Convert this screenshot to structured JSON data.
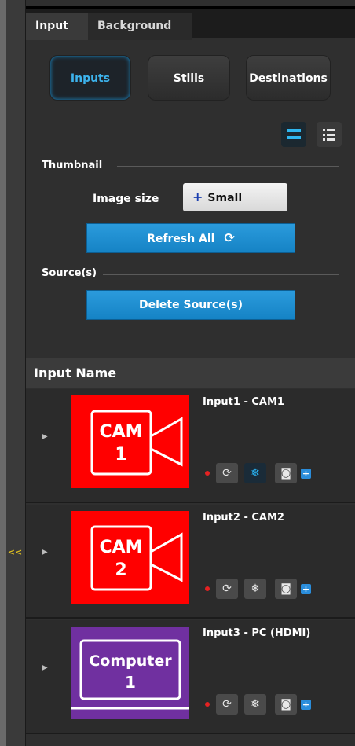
{
  "collapse_label": "<<",
  "tabs": [
    {
      "label": "Input"
    },
    {
      "label": "Background"
    }
  ],
  "modes": [
    {
      "label": "Inputs",
      "active": true
    },
    {
      "label": "Stills",
      "active": false
    },
    {
      "label": "Destinations",
      "active": false
    }
  ],
  "view_toggle": {
    "grid_icon": "grid-view-icon",
    "list_icon": "list-view-icon"
  },
  "thumbnail": {
    "section_label": "Thumbnail",
    "image_size_label": "Image size",
    "image_size_value": "Small",
    "refresh_label": "Refresh All"
  },
  "sources": {
    "section_label": "Source(s)",
    "delete_label": "Delete Source(s)"
  },
  "list": {
    "header": "Input Name",
    "items": [
      {
        "title": "Input1 - CAM1",
        "thumb_line1": "CAM",
        "thumb_line2": "1",
        "thumb_type": "camera",
        "color": "#ff0000",
        "freeze_active": true
      },
      {
        "title": "Input2 - CAM2",
        "thumb_line1": "CAM",
        "thumb_line2": "2",
        "thumb_type": "camera",
        "color": "#ff0000",
        "freeze_active": false
      },
      {
        "title": "Input3 - PC (HDMI)",
        "thumb_line1": "Computer",
        "thumb_line2": "1",
        "thumb_type": "computer",
        "color": "#7030a0",
        "freeze_active": false
      }
    ]
  },
  "colors": {
    "accent": "#2fb7f0",
    "button_blue": "#1f8fd2",
    "record": "#e52222"
  }
}
